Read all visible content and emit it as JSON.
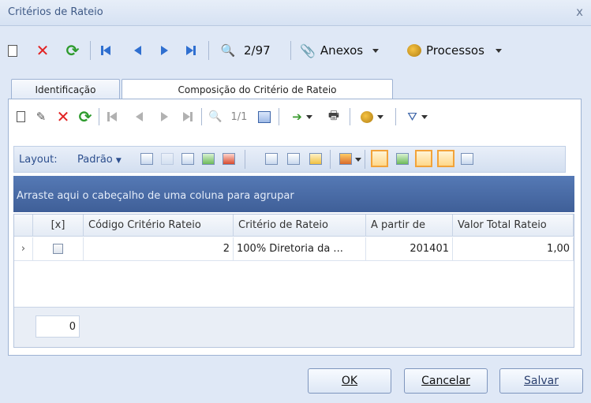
{
  "window": {
    "title": "Critérios de Rateio",
    "close": "x"
  },
  "toolbar": {
    "record_counter": "2/97",
    "anexos_label": "Anexos",
    "processos_label": "Processos"
  },
  "tabs": [
    {
      "label": "Identificação",
      "active": false
    },
    {
      "label": "Composição do Critério de Rateio",
      "active": true
    }
  ],
  "subtoolbar": {
    "record_counter": "1/1"
  },
  "layoutbar": {
    "layout_label": "Layout:",
    "preset_label": "Padrão"
  },
  "grid": {
    "group_hint": "Arraste aqui o cabeçalho de uma coluna para agrupar",
    "columns": [
      "[x]",
      "Código Critério Rateio",
      "Critério de Rateio",
      "A partir de",
      "Valor Total Rateio"
    ],
    "rows": [
      {
        "codigo": "2",
        "criterio": "100% Diretoria da ...",
        "a_partir": "201401",
        "valor": "1,00"
      }
    ],
    "footer_count": "0"
  },
  "buttons": {
    "ok": "OK",
    "cancelar": "Cancelar",
    "salvar": "Salvar"
  },
  "colors": {
    "accent": "#3f5f98",
    "title": "#3f5a86",
    "delete": "#e22222",
    "refresh": "#2e9b2e"
  }
}
